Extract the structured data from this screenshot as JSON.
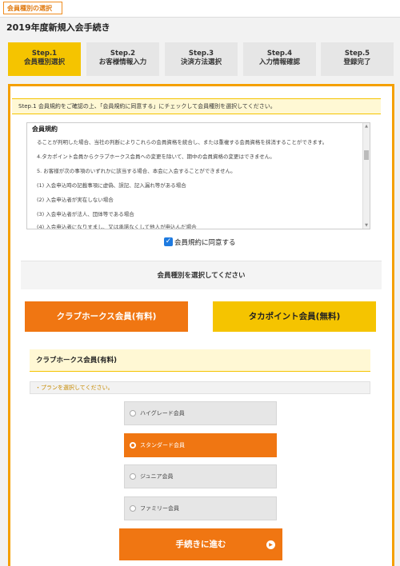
{
  "topbar": {
    "tab_label": "会員種別の選択"
  },
  "page_title": "2019年度新規入会手続き",
  "steps": [
    {
      "num": "Step.1",
      "label": "会員種別選択",
      "active": true
    },
    {
      "num": "Step.2",
      "label": "お客様情報入力",
      "active": false
    },
    {
      "num": "Step.3",
      "label": "決済方法選択",
      "active": false
    },
    {
      "num": "Step.4",
      "label": "入力情報確認",
      "active": false
    },
    {
      "num": "Step.5",
      "label": "登録完了",
      "active": false
    }
  ],
  "instruction": "Step.1 会員規約をご確認の上、「会員規約に同意する」にチェックして会員種別を選択してください。",
  "terms": {
    "title": "会員規約",
    "lines": [
      "ることが判明した場合、当社の判断によりこれらの会員資格を統合し、または重複する会員資格を抹消することができます。",
      "4.タカポイント会員からクラブホークス会員への変更を除いて、期中の会員資格の変更はできません。",
      "5. お客様が次の事項のいずれかに該当する場合、本会に入会することができません。",
      "(1) 入会申込時の記載事項に虚偽、誤記、記入漏れ等がある場合",
      "(2) 入会申込者が実在しない場合",
      "(3) 入会申込者が法人、団体等である場合",
      "(4) 入会申込者になりすまし、又は承諾なくして他人が申込んだ場合"
    ]
  },
  "agree": {
    "label": "会員規約に同意する",
    "checked": true
  },
  "select_heading": "会員種別を選択してください",
  "member_types": {
    "hawks": "クラブホークス会員(有料)",
    "taka": "タカポイント会員(無料)"
  },
  "plan_section": {
    "heading": "クラブホークス会員(有料)",
    "prompt": "・プランを選択してください。",
    "plans": [
      {
        "label": "ハイグレード会員",
        "selected": false
      },
      {
        "label": "スタンダード会員",
        "selected": true
      },
      {
        "label": "ジュニア会員",
        "selected": false
      },
      {
        "label": "ファミリー会員",
        "selected": false
      }
    ]
  },
  "proceed_label": "手続きに進む",
  "colors": {
    "orange": "#f07612",
    "yellow": "#f5c400",
    "frame": "#f5a000",
    "checkbox": "#1e7ae0"
  }
}
